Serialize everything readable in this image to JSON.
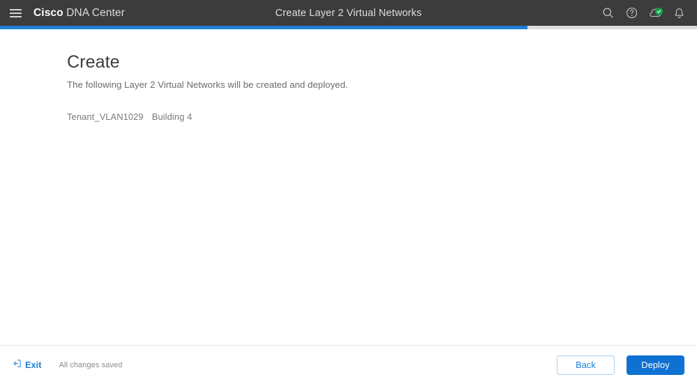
{
  "header": {
    "menu_icon": "hamburger-menu-icon",
    "brand_primary": "Cisco",
    "brand_secondary": "DNA Center",
    "title": "Create Layer 2 Virtual Networks",
    "icons": [
      {
        "name": "search-icon",
        "label": "Search"
      },
      {
        "name": "help-icon",
        "label": "Help"
      },
      {
        "name": "cloud-status-icon",
        "label": "Cloud Connected"
      },
      {
        "name": "notifications-bell-icon",
        "label": "Notifications"
      }
    ],
    "background_color": "#3c3c3c"
  },
  "progress": {
    "percent": 75.7,
    "fill_color": "#1e7fd4",
    "track_color": "#dcdcdc"
  },
  "main": {
    "title": "Create",
    "subtitle": "The following Layer 2 Virtual Networks will be created and deployed.",
    "virtual_networks": [
      {
        "name": "Tenant_VLAN1029",
        "site": "Building 4"
      }
    ]
  },
  "footer": {
    "exit_icon": "exit-arrow-icon",
    "exit_label": "Exit",
    "save_status": "All changes saved",
    "back_label": "Back",
    "deploy_label": "Deploy",
    "accent_color": "#0f72d3",
    "link_color": "#1b7fd4"
  }
}
